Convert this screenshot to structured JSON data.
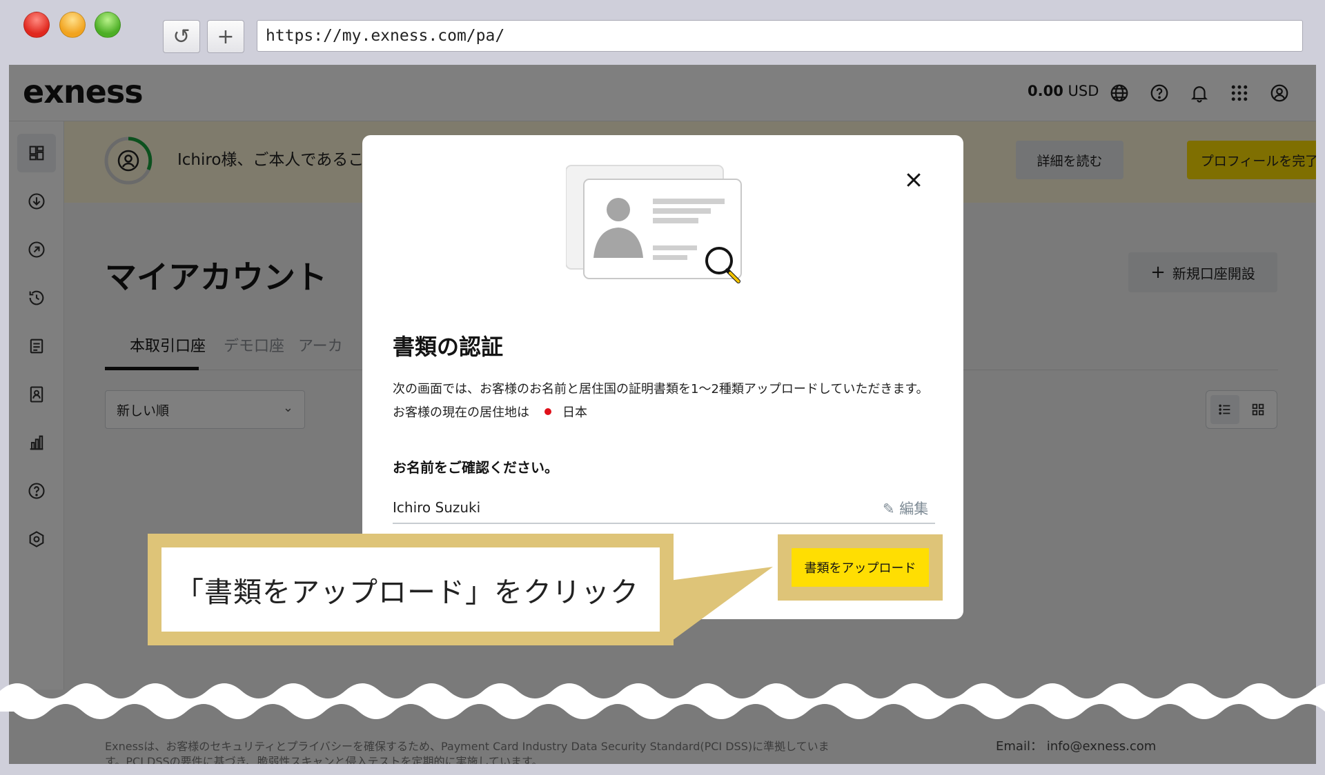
{
  "browser": {
    "url": "https://my.exness.com/pa/",
    "reload_label": "↺",
    "newtab_label": "+"
  },
  "topbar": {
    "logo": "exness",
    "balance_amount": "0.00",
    "balance_currency": "USD",
    "icons": [
      "globe-icon",
      "help-icon",
      "bell-icon",
      "apps-grid-icon",
      "account-icon"
    ]
  },
  "sidebar": {
    "icons": [
      "dashboard-icon",
      "deposit-icon",
      "withdraw-icon",
      "history-icon",
      "document-icon",
      "id-card-icon",
      "analytics-icon",
      "help-icon",
      "settings-icon"
    ]
  },
  "banner": {
    "text": "Ichiro様、ご本人であることを確",
    "read_more": "詳細を読む",
    "complete_profile": "プロフィールを完了"
  },
  "main": {
    "title": "マイアカウント",
    "new_account": "新規口座開設",
    "tabs": [
      {
        "label": "本取引口座"
      },
      {
        "label": "デモ口座"
      },
      {
        "label": "アーカ"
      }
    ],
    "sort_label": "新しい順"
  },
  "modal": {
    "title": "書類の認証",
    "description": "次の画面では、お客様のお名前と居住国の証明書類を1～2種類アップロードしていただきます。",
    "country_label": "お客様の現在の居住地は",
    "country": "日本",
    "confirm_name_label": "お名前をご確認ください。",
    "name": "Ichiro Suzuki",
    "edit_label": "編集",
    "upload_button": "書類をアップロード"
  },
  "callout": {
    "text": "「書類をアップロード」をクリック"
  },
  "footer": {
    "text": "Exnessは、お客様のセキュリティとプライバシーを確保するため、Payment Card Industry Data Security Standard(PCI DSS)に準拠しています。PCI DSSの要件に基づき、脆弱性スキャンと侵入テストを定期的に実施しています。",
    "email_label": "Email：",
    "email": "info@exness.com"
  },
  "colors": {
    "brand_yellow": "#ffde02",
    "callout_gold": "#dec478",
    "banner_bg": "#fff7d8",
    "progress_green": "#19a33d"
  }
}
